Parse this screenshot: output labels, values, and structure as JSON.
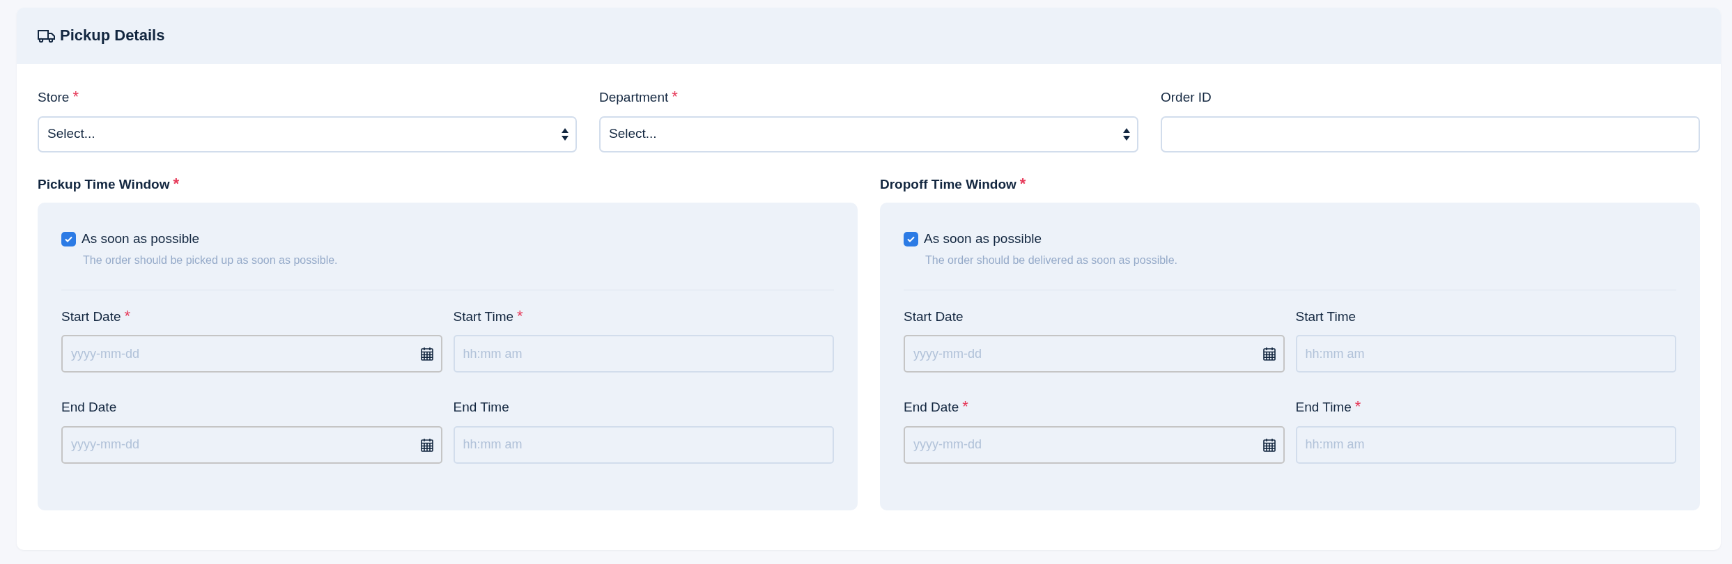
{
  "card": {
    "title": "Pickup Details"
  },
  "fields": [
    {
      "label": "Store",
      "required_mark": "*",
      "kind": "select",
      "value": "Select..."
    },
    {
      "label": "Department",
      "required_mark": "*",
      "kind": "select",
      "value": "Select..."
    },
    {
      "label": "Order ID",
      "kind": "text"
    }
  ],
  "windows": [
    {
      "title": "Pickup Time Window",
      "required_mark": "*",
      "asap": {
        "label": "As soon as possible",
        "checked": true,
        "help": "The order should be picked up as soon as possible."
      },
      "fields": [
        {
          "label": "Start Date",
          "required_mark": "*",
          "kind": "date",
          "placeholder": "yyyy-mm-dd"
        },
        {
          "label": "Start Time",
          "required_mark": "*",
          "kind": "time",
          "placeholder": "hh:mm am"
        },
        {
          "label": "End Date",
          "kind": "date",
          "placeholder": "yyyy-mm-dd"
        },
        {
          "label": "End Time",
          "kind": "time",
          "placeholder": "hh:mm am"
        }
      ]
    },
    {
      "title": "Dropoff Time Window",
      "required_mark": "*",
      "asap": {
        "label": "As soon as possible",
        "checked": true,
        "help": "The order should be delivered as soon as possible."
      },
      "fields": [
        {
          "label": "Start Date",
          "kind": "date",
          "placeholder": "yyyy-mm-dd"
        },
        {
          "label": "Start Time",
          "kind": "time",
          "placeholder": "hh:mm am"
        },
        {
          "label": "End Date",
          "required_mark": "*",
          "kind": "date",
          "placeholder": "yyyy-mm-dd"
        },
        {
          "label": "End Time",
          "required_mark": "*",
          "kind": "time",
          "placeholder": "hh:mm am"
        }
      ]
    }
  ]
}
